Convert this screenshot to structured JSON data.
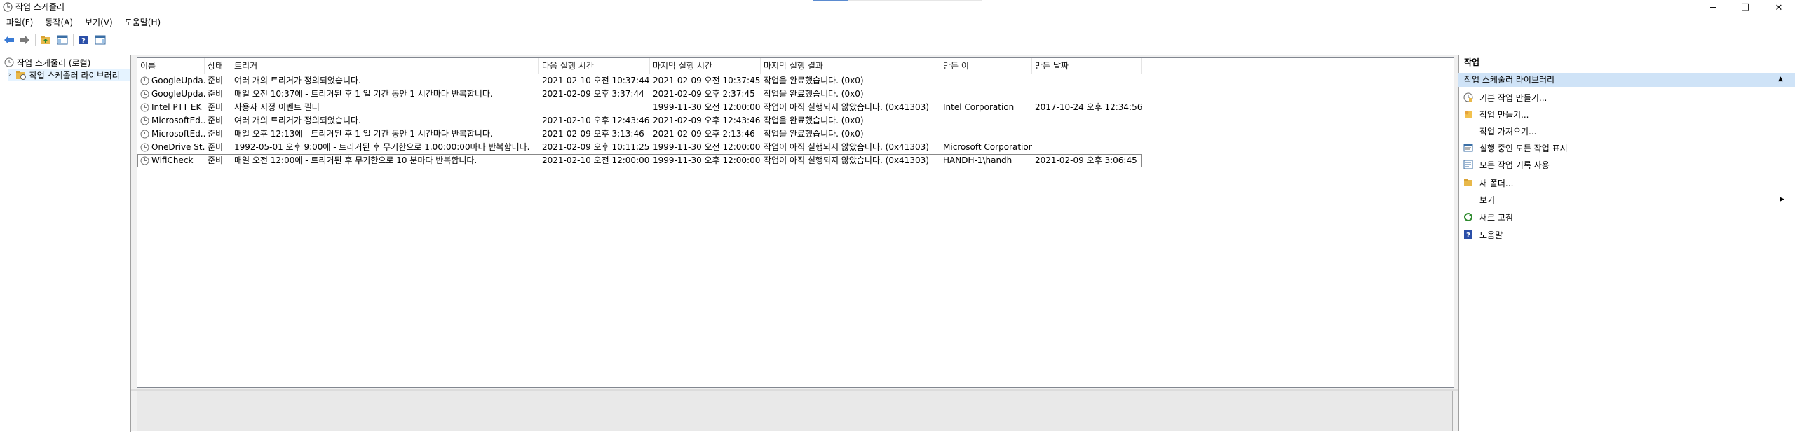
{
  "window": {
    "title": "작업 스케줄러",
    "minimize": "─",
    "maximize": "❐",
    "close": "✕"
  },
  "menu": [
    "파일(F)",
    "동작(A)",
    "보기(V)",
    "도움말(H)"
  ],
  "tree": {
    "root": "작업 스케줄러 (로컬)",
    "library": "작업 스케줄러 라이브러리"
  },
  "table": {
    "columns": [
      "이름",
      "상태",
      "트리거",
      "다음 실행 시간",
      "마지막 실행 시간",
      "마지막 실행 결과",
      "만든 이",
      "만든 날짜"
    ],
    "rows": [
      [
        "GoogleUpda...",
        "준비",
        "여러 개의 트리거가 정의되었습니다.",
        "2021-02-10 오전 10:37:44",
        "2021-02-09 오전 10:37:45",
        "작업을 완료했습니다. (0x0)",
        "",
        ""
      ],
      [
        "GoogleUpda...",
        "준비",
        "매일 오전 10:37에 - 트리거된 후 1 일 기간 동안 1 시간마다 반복합니다.",
        "2021-02-09 오후 3:37:44",
        "2021-02-09 오후 2:37:45",
        "작업을 완료했습니다. (0x0)",
        "",
        ""
      ],
      [
        "Intel PTT EK ...",
        "준비",
        "사용자 지정 이벤트 필터",
        "",
        "1999-11-30 오전 12:00:00",
        "작업이 아직 실행되지 않았습니다. (0x41303)",
        "Intel Corporation",
        "2017-10-24 오후 12:34:56"
      ],
      [
        "MicrosoftEd...",
        "준비",
        "여러 개의 트리거가 정의되었습니다.",
        "2021-02-10 오후 12:43:46",
        "2021-02-09 오후 12:43:46",
        "작업을 완료했습니다. (0x0)",
        "",
        ""
      ],
      [
        "MicrosoftEd...",
        "준비",
        "매일 오후 12:13에 - 트리거된 후 1 일 기간 동안 1 시간마다 반복합니다.",
        "2021-02-09 오후 3:13:46",
        "2021-02-09 오후 2:13:46",
        "작업을 완료했습니다. (0x0)",
        "",
        ""
      ],
      [
        "OneDrive St...",
        "준비",
        "1992-05-01 오후 9:00에 - 트리거된 후 무기한으로 1.00:00:00마다 반복합니다.",
        "2021-02-09 오후 10:11:25",
        "1999-11-30 오전 12:00:00",
        "작업이 아직 실행되지 않았습니다. (0x41303)",
        "Microsoft Corporation",
        ""
      ],
      [
        "WifiCheck",
        "준비",
        "매일 오전 12:00에 - 트리거된 후 무기한으로 10 분마다 반복합니다.",
        "2021-02-10 오전 12:00:00",
        "1999-11-30 오후 12:00:00",
        "작업이 아직 실행되지 않았습니다. (0x41303)",
        "HANDH-1\\handh",
        "2021-02-09 오후 3:06:45"
      ]
    ]
  },
  "actions": {
    "title": "작업",
    "group": "작업 스케줄러 라이브러리",
    "items": [
      {
        "label": "기본 작업 만들기...",
        "icon": "basic-task-icon"
      },
      {
        "label": "작업 만들기...",
        "icon": "create-task-icon"
      },
      {
        "label": "작업 가져오기...",
        "icon": ""
      },
      {
        "label": "실행 중인 모든 작업 표시",
        "icon": "running-tasks-icon"
      },
      {
        "label": "모든 작업 기록 사용",
        "icon": "history-icon"
      },
      {
        "label": "새 폴더...",
        "icon": "folder-icon"
      },
      {
        "label": "보기",
        "icon": ""
      },
      {
        "label": "새로 고침",
        "icon": "refresh-icon"
      },
      {
        "label": "도움말",
        "icon": "help-icon"
      }
    ]
  },
  "colors": {
    "selection": "#e5f3ff",
    "actions_group": "#cfe3f7",
    "pane_bg": "#f0f0f0"
  }
}
